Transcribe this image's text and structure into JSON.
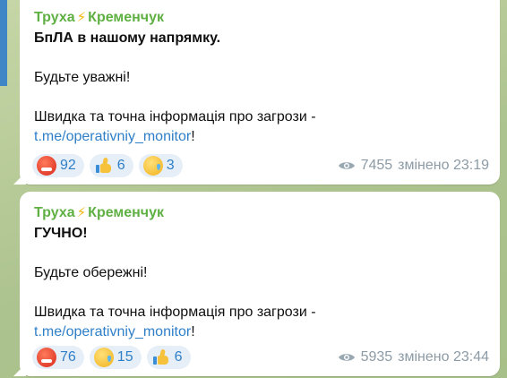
{
  "colors": {
    "channel_name": "#5fb042",
    "link": "#2f7fc8",
    "reaction_bg": "#e6eff8",
    "meta": "#8c9ba6"
  },
  "messages": [
    {
      "channel": "Труха",
      "channel_bolt": "⚡",
      "channel_city": "Кременчук",
      "headline": "БпЛА в нашому напрямку.",
      "line2": "Будьте уважні!",
      "info_text": "Швидка та точна інформація про загрози -",
      "link_text": "t.me/operativniy_monitor",
      "link_suffix": "!",
      "reactions": [
        {
          "icon": "angry-face-icon",
          "count": "92"
        },
        {
          "icon": "thumbs-up-icon",
          "count": "6"
        },
        {
          "icon": "crying-face-icon",
          "count": "3"
        }
      ],
      "views": "7455",
      "edited_label": "змінено 23:19"
    },
    {
      "channel": "Труха",
      "channel_bolt": "⚡",
      "channel_city": "Кременчук",
      "headline": "ГУЧНО!",
      "line2": "Будьте обережні!",
      "info_text": "Швидка та точна інформація про загрози -",
      "link_text": "t.me/operativniy_monitor",
      "link_suffix": "!",
      "reactions": [
        {
          "icon": "angry-face-icon",
          "count": "76"
        },
        {
          "icon": "crying-face-icon",
          "count": "15"
        },
        {
          "icon": "thumbs-up-icon",
          "count": "6"
        }
      ],
      "views": "5935",
      "edited_label": "змінено 23:44"
    }
  ]
}
